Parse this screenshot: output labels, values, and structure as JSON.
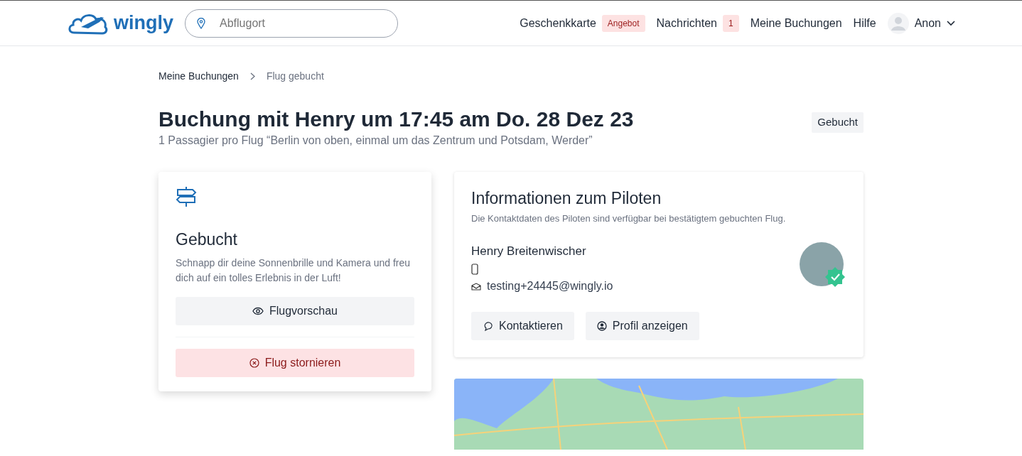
{
  "navbar": {
    "logo": "wingly",
    "search": {
      "placeholder": "Abflugort"
    },
    "links": [
      {
        "label": "Geschenkkarte",
        "badge": "Angebot"
      },
      {
        "label": "Nachrichten",
        "badge": "1"
      },
      {
        "label": "Meine Buchungen"
      },
      {
        "label": "Hilfe"
      }
    ],
    "user": {
      "name": "Anon"
    }
  },
  "breadcrumb": [
    {
      "label": "Meine Buchungen",
      "selected": false
    },
    {
      "label": "Flug gebucht",
      "selected": true
    }
  ],
  "header": {
    "title": "Buchung mit Henry um 17:45 am Do. 28 Dez 23",
    "subtitle": "1 Passagier pro Flug “Berlin von oben, einmal um das Zentrum und Potsdam, Werder”",
    "status": "Gebucht"
  },
  "status_card": {
    "title": "Gebucht",
    "text": "Schnapp dir deine Sonnenbrille und Kamera und freu dich auf ein tolles Erlebnis in der Luft!",
    "buttons": [
      {
        "label": "Flugvorschau",
        "kind": "preview"
      },
      {
        "label": "Flug stornieren",
        "kind": "cancel"
      }
    ]
  },
  "pilot_card": {
    "title": "Informationen zum Piloten",
    "note": "Die Kontaktdaten des Piloten sind verfügbar bei bestätigtem gebuchten Flug.",
    "name": "Henry Breitenwischer",
    "email": "testing+24445@wingly.io",
    "verified": true,
    "buttons": [
      {
        "label": "Kontaktieren",
        "kind": "chat"
      },
      {
        "label": "Profil anzeigen",
        "kind": "profile"
      }
    ]
  }
}
